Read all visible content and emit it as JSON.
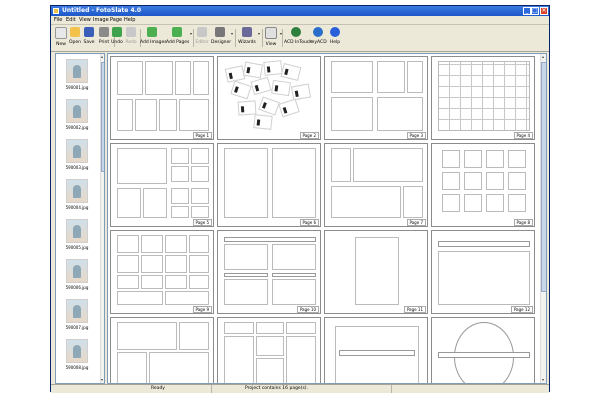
{
  "window": {
    "title": "Untitled - FotoSlate 4.0",
    "controls": {
      "minimize": "_",
      "maximize": "□",
      "close": "✕"
    }
  },
  "menu": [
    "File",
    "Edit",
    "View",
    "Image",
    "Page",
    "Help"
  ],
  "toolbar": [
    {
      "label": "New",
      "icon": "new-icon",
      "color": "#e8e8e8"
    },
    {
      "label": "Open",
      "icon": "folder-open-icon",
      "color": "#f2c24a"
    },
    {
      "label": "Save",
      "icon": "save-icon",
      "color": "#3a5fb8"
    },
    {
      "label": "Print",
      "icon": "printer-icon",
      "color": "#8a8a8a"
    },
    {
      "label": "Undo",
      "icon": "undo-icon",
      "color": "#3fa34d"
    },
    {
      "label": "Redo",
      "icon": "redo-icon",
      "color": "#b0b0b0",
      "disabled": true
    },
    {
      "label": "Add Images",
      "icon": "add-images-icon",
      "color": "#4caf50"
    },
    {
      "label": "Add Pages",
      "icon": "add-pages-icon",
      "color": "#4caf50",
      "dropdown": true
    },
    {
      "label": "Editor",
      "icon": "editor-icon",
      "color": "#b0b0b0",
      "disabled": true
    },
    {
      "label": "Designer",
      "icon": "designer-icon",
      "color": "#777777",
      "dropdown": true
    },
    {
      "label": "Wizards",
      "icon": "wizard-icon",
      "color": "#6a6a9a",
      "dropdown": true
    },
    {
      "label": "View",
      "icon": "view-icon",
      "color": "#e0e0e0",
      "dropdown": true
    },
    {
      "label": "ACD InTouch",
      "icon": "acd-intouch-icon",
      "color": "#2f7f3f"
    },
    {
      "label": "myACD",
      "icon": "myacd-icon",
      "color": "#2a6fc9"
    },
    {
      "label": "Help",
      "icon": "help-icon",
      "color": "#2a5fd9"
    }
  ],
  "images": [
    {
      "name": "590001.jpg"
    },
    {
      "name": "590002.jpg"
    },
    {
      "name": "590003.jpg"
    },
    {
      "name": "590004.jpg"
    },
    {
      "name": "590005.jpg"
    },
    {
      "name": "590006.jpg"
    },
    {
      "name": "590007.jpg"
    },
    {
      "name": "590008.jpg"
    }
  ],
  "pages": [
    {
      "label": "Page 1"
    },
    {
      "label": "Page 2"
    },
    {
      "label": "Page 3"
    },
    {
      "label": "Page 4"
    },
    {
      "label": "Page 5"
    },
    {
      "label": "Page 6"
    },
    {
      "label": "Page 7"
    },
    {
      "label": "Page 8"
    },
    {
      "label": "Page 9"
    },
    {
      "label": "Page 10"
    },
    {
      "label": "Page 11"
    },
    {
      "label": "Page 12"
    },
    {
      "label": ""
    },
    {
      "label": ""
    },
    {
      "label": ""
    },
    {
      "label": ""
    }
  ],
  "status": {
    "left": "Ready",
    "right": "Project contains 16 page(s)."
  }
}
